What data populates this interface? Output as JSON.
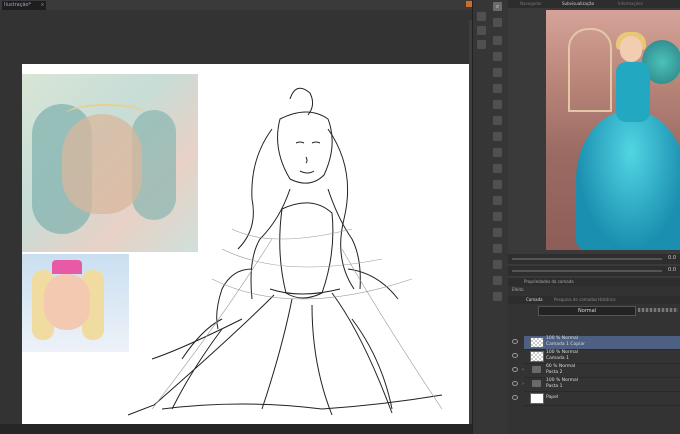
{
  "document_tab": {
    "title": "Ilustração*",
    "close": "x"
  },
  "navigator": {
    "tabs": [
      "Navegador",
      "Subvisualização",
      "Informações"
    ],
    "zoom_value": "0.0",
    "rotate_value": "0.0"
  },
  "layer_properties": {
    "title": "Propriedades da camada",
    "effect": "Efeito"
  },
  "layer_panel": {
    "tabs": [
      "Camada",
      "Pesquisa de camadas",
      "Histórico"
    ],
    "blend_mode": "Normal",
    "layers": [
      {
        "line1": "100 % Normal",
        "line2": "Camada 1 Copiar",
        "type": "raster",
        "selected": true
      },
      {
        "line1": "100 % Normal",
        "line2": "Camada 1",
        "type": "raster",
        "selected": false
      },
      {
        "line1": "60 % Normal",
        "line2": "Pasta 2",
        "type": "folder",
        "selected": false
      },
      {
        "line1": "100 % Normal",
        "line2": "Pasta 1",
        "type": "folder",
        "selected": false
      },
      {
        "line1": "",
        "line2": "Papel",
        "type": "paper",
        "selected": false
      }
    ]
  },
  "toolstrip": {
    "icons": [
      "zoom-icon",
      "move-icon",
      "pen-icon",
      "eraser-icon",
      "brush-icon",
      "select-icon",
      "fill-icon",
      "gradient-icon",
      "text-icon",
      "ruler-icon",
      "shape-icon",
      "frame-icon",
      "correct-icon",
      "lasso-icon",
      "eyedropper-icon",
      "blend-icon",
      "figure-icon",
      "spray-icon",
      "decoration-icon",
      "operation-icon"
    ]
  },
  "colors": {
    "accent": "#4d5f82",
    "orange": "#d26b2a"
  }
}
